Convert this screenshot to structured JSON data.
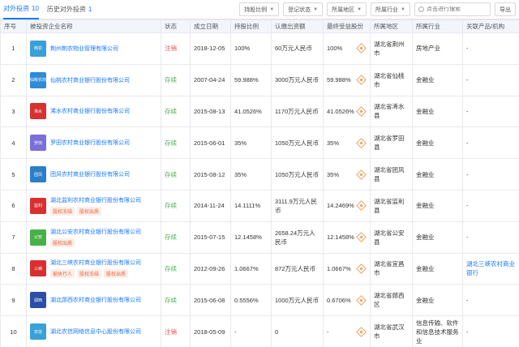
{
  "tabs": [
    {
      "label": "对外投资",
      "count": "10"
    },
    {
      "label": "历史对外投资",
      "count": "1"
    }
  ],
  "filters": [
    {
      "label": "持股比例"
    },
    {
      "label": "登记状态"
    },
    {
      "label": "所属地区"
    },
    {
      "label": "所属行业"
    }
  ],
  "search": {
    "placeholder": "点击进行搜索"
  },
  "export_label": "导出",
  "columns": [
    "序号",
    "被投资企业名称",
    "状态",
    "成立日期",
    "持股比例",
    "认缴出资额",
    "最终受益股份",
    "所属地区",
    "所属行业",
    "关联产品/机构"
  ],
  "rows": [
    {
      "no": "1",
      "logo_text": "荆农",
      "logo_color": "#3aa0d8",
      "name": "荆州荆农物业管理有限公司",
      "badges": [],
      "status": "注销",
      "status_color": "red",
      "date": "2018-12-05",
      "ratio": "100%",
      "capital": "60万元人民币",
      "final": "100%",
      "region": "湖北省荆州市",
      "industry": "房地产业",
      "related": "-"
    },
    {
      "no": "2",
      "logo_text": "仙桃农商",
      "logo_color": "#2e8bd8",
      "name": "仙桃农村商业银行股份有限公司",
      "badges": [],
      "status": "存续",
      "status_color": "green",
      "date": "2007-04-24",
      "ratio": "59.988%",
      "capital": "3000万元人民币",
      "final": "59.988%",
      "region": "湖北省仙桃市",
      "industry": "金融业",
      "related": "-"
    },
    {
      "no": "3",
      "logo_text": "浠水",
      "logo_color": "#d83030",
      "name": "浠水农村商业银行股份有限公司",
      "badges": [],
      "status": "存续",
      "status_color": "green",
      "date": "2015-08-13",
      "ratio": "41.0526%",
      "capital": "1170万元人民币",
      "final": "41.0526%",
      "region": "湖北省浠水县",
      "industry": "金融业",
      "related": "-"
    },
    {
      "no": "4",
      "logo_text": "罗田",
      "logo_color": "#7a6fd8",
      "name": "罗田农村商业银行股份有限公司",
      "badges": [],
      "status": "存续",
      "status_color": "green",
      "date": "2015-06-01",
      "ratio": "35%",
      "capital": "1050万元人民币",
      "final": "35%",
      "region": "湖北省罗田县",
      "industry": "金融业",
      "related": "-"
    },
    {
      "no": "5",
      "logo_text": "团风",
      "logo_color": "#2a7fc8",
      "name": "团风农村商业银行股份有限公司",
      "badges": [],
      "status": "存续",
      "status_color": "green",
      "date": "2015-08-12",
      "ratio": "35%",
      "capital": "1050万元人民币",
      "final": "35%",
      "region": "湖北省团风县",
      "industry": "金融业",
      "related": "-"
    },
    {
      "no": "6",
      "logo_text": "监利",
      "logo_color": "#d83030",
      "name": "湖北监利农村商业银行股份有限公司",
      "badges": [
        "股权冻结",
        "股权出质"
      ],
      "status": "存续",
      "status_color": "green",
      "date": "2014-11-24",
      "ratio": "14.1111%",
      "capital": "3111.9万元人民币",
      "final": "14.2469%",
      "region": "湖北省监利县",
      "industry": "金融业",
      "related": "-"
    },
    {
      "no": "7",
      "logo_text": "公安",
      "logo_color": "#48b048",
      "name": "湖北公安农村商业银行股份有限公司",
      "badges": [
        "股权出质"
      ],
      "status": "存续",
      "status_color": "green",
      "date": "2015-07-15",
      "ratio": "12.1458%",
      "capital": "2658.24万元人民币",
      "final": "12.1458%",
      "region": "湖北省公安县",
      "industry": "金融业",
      "related": "-"
    },
    {
      "no": "8",
      "logo_text": "三峡",
      "logo_color": "#d83030",
      "name": "湖北三峡农村商业银行股份有限公司",
      "badges": [
        "被执行人",
        "股权冻结",
        "股权出质"
      ],
      "status": "存续",
      "status_color": "green",
      "date": "2012-09-26",
      "ratio": "1.0667%",
      "capital": "872万元人民币",
      "final": "1.0667%",
      "region": "湖北省宜昌市",
      "industry": "金融业",
      "related": "湖北三峡农村商业银行"
    },
    {
      "no": "9",
      "logo_text": "郧西",
      "logo_color": "#2a4fa8",
      "name": "湖北郧西农村商业银行股份有限公司",
      "badges": [],
      "status": "存续",
      "status_color": "green",
      "date": "2015-06-08",
      "ratio": "0.5556%",
      "capital": "1000万元人民币",
      "final": "0.6706%",
      "region": "湖北省郧西区",
      "industry": "金融业",
      "related": "-"
    },
    {
      "no": "10",
      "logo_text": "农信",
      "logo_color": "#3aa0d8",
      "name": "湖北农信网络信息中心股份有限公司",
      "badges": [],
      "status": "注销",
      "status_color": "red",
      "date": "2018-05-09",
      "ratio": "-",
      "capital": "0",
      "final": "-",
      "region": "湖北省武汉市",
      "industry": "信息传输、软件和信息技术服务业",
      "related": "-"
    }
  ]
}
